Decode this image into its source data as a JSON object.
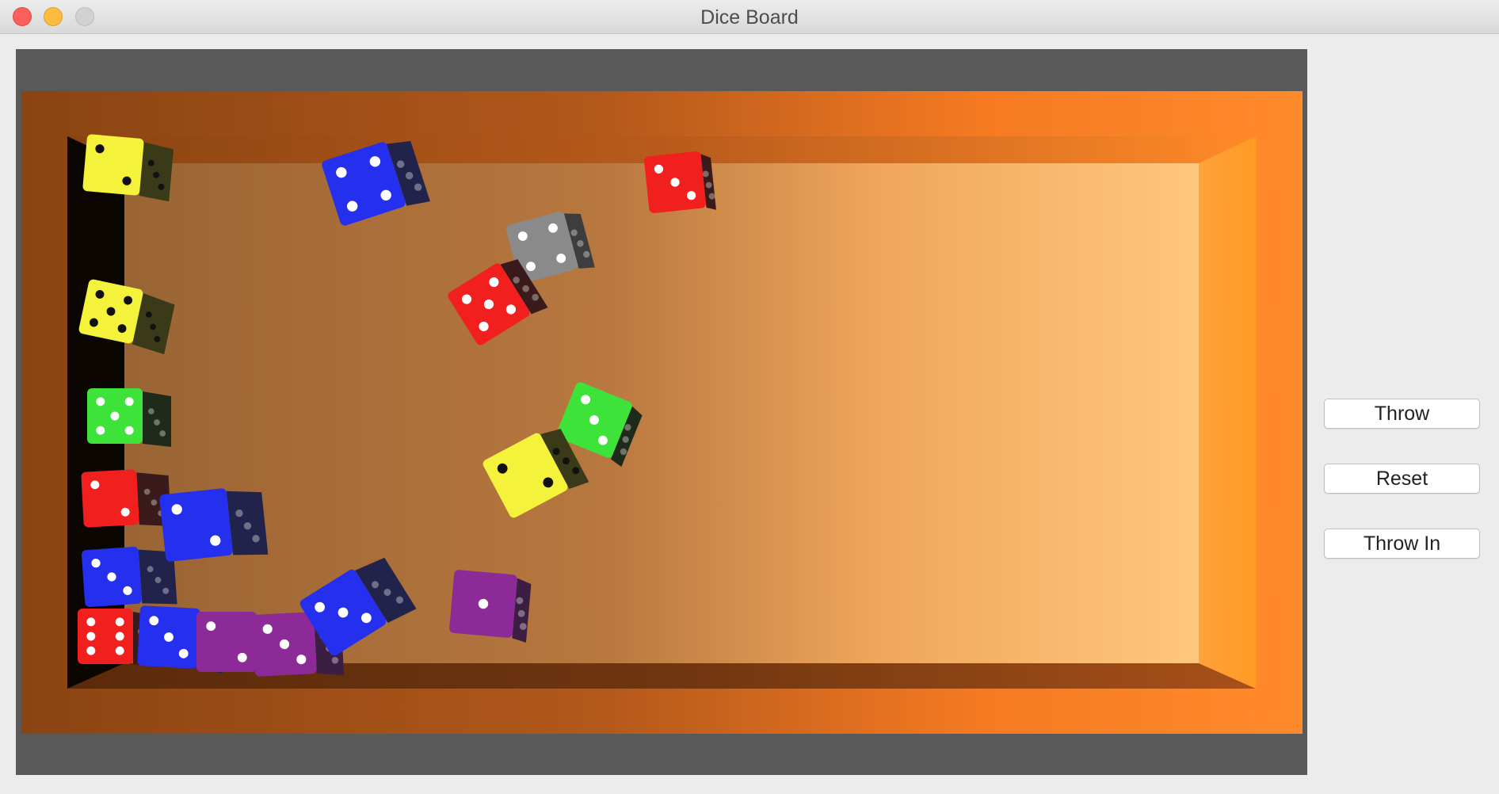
{
  "window": {
    "title": "Dice Board"
  },
  "buttons": {
    "throw": "Throw",
    "reset": "Reset",
    "throw_in": "Throw In"
  },
  "board": {
    "colors": {
      "rim_dark": "#7a3a0c",
      "rim_light": "#ff8a26",
      "floor_dark": "#9c6633",
      "floor_light": "#ffc27a",
      "frame": "#595959"
    }
  },
  "dice": [
    {
      "color": "yellow",
      "pip": "black",
      "top_face": 2
    },
    {
      "color": "yellow",
      "pip": "black",
      "top_face": 5
    },
    {
      "color": "green",
      "pip": "white",
      "top_face": 5
    },
    {
      "color": "red",
      "pip": "white",
      "top_face": 2
    },
    {
      "color": "blue",
      "pip": "white",
      "top_face": 3
    },
    {
      "color": "blue",
      "pip": "white",
      "top_face": 2
    },
    {
      "color": "red",
      "pip": "white",
      "top_face": 6
    },
    {
      "color": "blue",
      "pip": "white",
      "top_face": 3
    },
    {
      "color": "purple",
      "pip": "white",
      "top_face": 2
    },
    {
      "color": "purple",
      "pip": "white",
      "top_face": 3
    },
    {
      "color": "blue",
      "pip": "white",
      "top_face": 3
    },
    {
      "color": "blue",
      "pip": "white",
      "top_face": 4
    },
    {
      "color": "gray",
      "pip": "white",
      "top_face": 4
    },
    {
      "color": "red",
      "pip": "white",
      "top_face": 5
    },
    {
      "color": "red",
      "pip": "white",
      "top_face": 3
    },
    {
      "color": "green",
      "pip": "white",
      "top_face": 3
    },
    {
      "color": "yellow",
      "pip": "black",
      "top_face": 2
    },
    {
      "color": "purple",
      "pip": "white",
      "top_face": 1
    }
  ],
  "die_colors": {
    "yellow": {
      "top": "#f4f23a",
      "side": "#3a3a18"
    },
    "green": {
      "top": "#3ee33a",
      "side": "#1f2a1a"
    },
    "red": {
      "top": "#f21f1f",
      "side": "#3a1a1a"
    },
    "blue": {
      "top": "#2430ee",
      "side": "#22234a"
    },
    "purple": {
      "top": "#8c2a98",
      "side": "#3c1e42"
    },
    "gray": {
      "top": "#8a8a8a",
      "side": "#3d3d3d"
    }
  }
}
